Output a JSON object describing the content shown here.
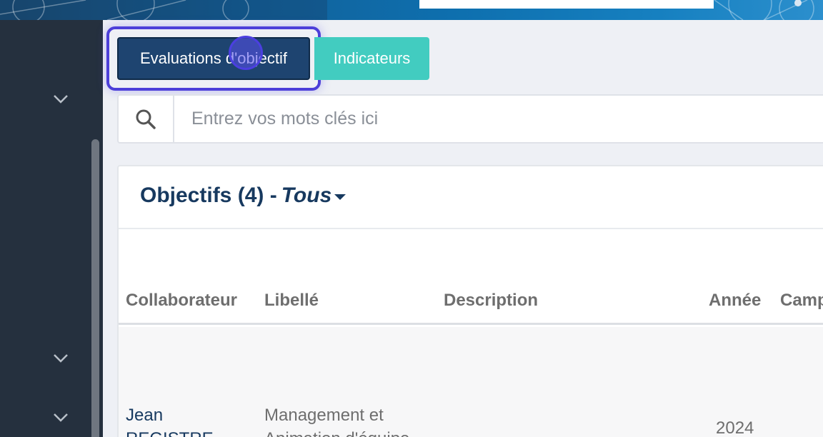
{
  "tabs": {
    "evaluations_label": "Evaluations d'objectif",
    "indicators_label": "Indicateurs"
  },
  "search": {
    "placeholder": "Entrez vos mots clés ici",
    "icon": "search-icon"
  },
  "card": {
    "title": "Objectifs (4) - ",
    "filter_label": "Tous"
  },
  "table": {
    "headers": [
      "Collaborateur",
      "Libellé",
      "Description",
      "Année",
      "Camp"
    ],
    "rows": [
      {
        "collaborateur_line1": "Jean",
        "collaborateur_line2": "REGISTRE",
        "libelle_line1": "Management et",
        "libelle_line2": "Animation d'équipe",
        "annee": "2024"
      }
    ]
  },
  "sidebar": {
    "chevron_icon": "chevron-down-icon"
  },
  "colors": {
    "primary_button": "#1e4470",
    "secondary_button": "#42ccc0",
    "sidebar": "#25303e",
    "title": "#17395f"
  }
}
